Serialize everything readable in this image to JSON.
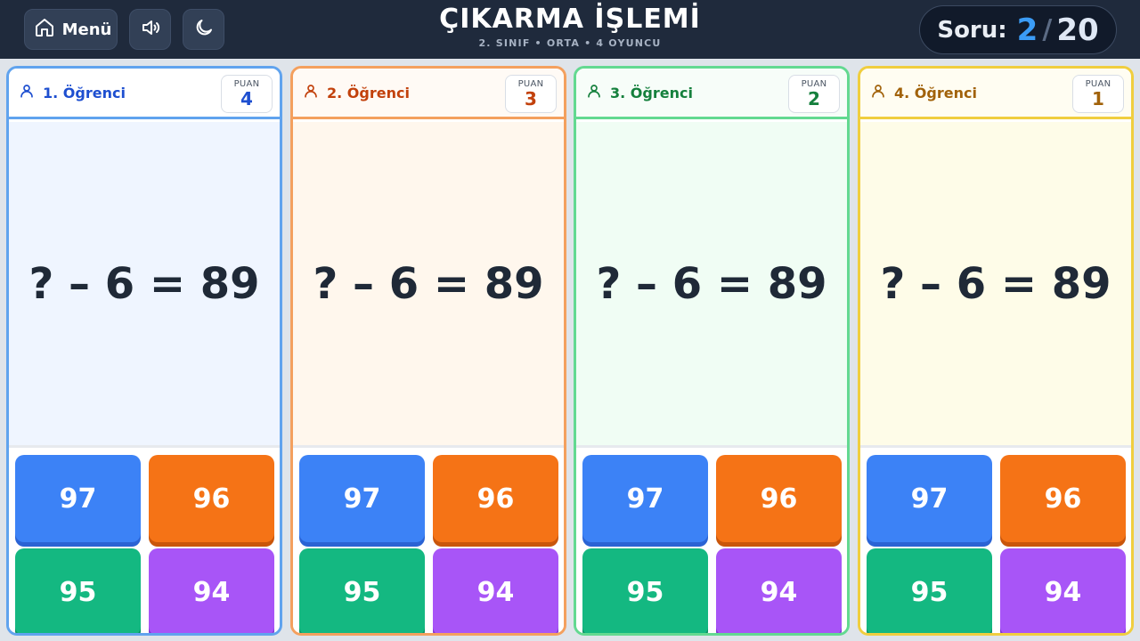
{
  "header": {
    "menu_label": "Menü",
    "menu_icon": "home-icon",
    "sound_icon": "speaker-icon",
    "theme_icon": "moon-icon",
    "title": "ÇIKARMA İŞLEMİ",
    "subtitle": "2. SINIF • ORTA • 4 OYUNCU",
    "counter": {
      "label": "Soru:",
      "current": "2",
      "separator": "/",
      "total": "20"
    }
  },
  "players": [
    {
      "name": "1. Öğrenci",
      "score_label": "PUAN",
      "score": "4",
      "question": "? – 6 = 89",
      "answers": [
        "97",
        "96",
        "95",
        "94"
      ],
      "color": "#60a3ee"
    },
    {
      "name": "2. Öğrenci",
      "score_label": "PUAN",
      "score": "3",
      "question": "? – 6 = 89",
      "answers": [
        "97",
        "96",
        "95",
        "94"
      ],
      "color": "#f4a05e"
    },
    {
      "name": "3. Öğrenci",
      "score_label": "PUAN",
      "score": "2",
      "question": "? – 6 = 89",
      "answers": [
        "97",
        "96",
        "95",
        "94"
      ],
      "color": "#63d991"
    },
    {
      "name": "4. Öğrenci",
      "score_label": "PUAN",
      "score": "1",
      "question": "? – 6 = 89",
      "answers": [
        "97",
        "96",
        "95",
        "94"
      ],
      "color": "#f0ce3f"
    }
  ],
  "answer_colors": [
    "#3c82f6",
    "#f57316",
    "#14b881",
    "#a855f7"
  ]
}
